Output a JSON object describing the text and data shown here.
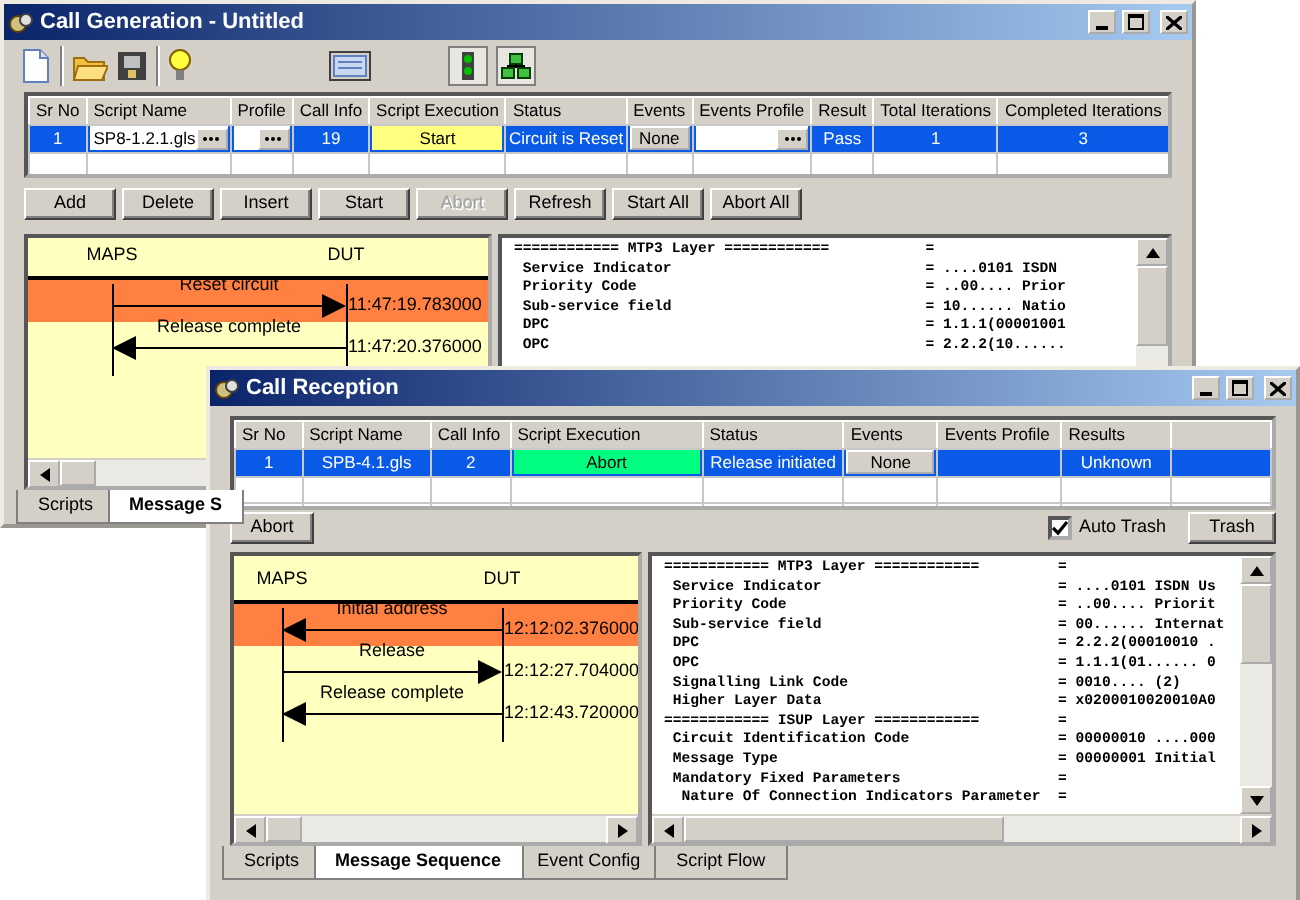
{
  "windows": [
    {
      "kind": "generation",
      "title": "Call Generation - Untitled",
      "table": {
        "columns": [
          "Sr No",
          "Script Name",
          "Profile",
          "Call Info",
          "Script Execution",
          "Status",
          "Events",
          "Events Profile",
          "Result",
          "Total Iterations",
          "Completed Iterations"
        ],
        "rows": [
          {
            "selected": true,
            "cells": [
              {
                "kind": "text",
                "text": "1"
              },
              {
                "kind": "combo",
                "text": "SP8-1.2.1.gls"
              },
              {
                "kind": "combo"
              },
              {
                "kind": "text",
                "text": "19"
              },
              {
                "kind": "exec",
                "text": "Start",
                "color": "#ffff80"
              },
              {
                "kind": "text",
                "text": "Circuit is Reset"
              },
              {
                "kind": "button",
                "text": "None"
              },
              {
                "kind": "combo"
              },
              {
                "kind": "text",
                "text": "Pass"
              },
              {
                "kind": "text",
                "text": "1"
              },
              {
                "kind": "text",
                "text": "3"
              }
            ]
          }
        ]
      },
      "buttons": [
        {
          "label": "Add",
          "disabled": false
        },
        {
          "label": "Delete",
          "disabled": false
        },
        {
          "label": "Insert",
          "disabled": false
        },
        {
          "label": "Start",
          "disabled": false
        },
        {
          "label": "Abort",
          "disabled": true
        },
        {
          "label": "Refresh",
          "disabled": false
        },
        {
          "label": "Start All",
          "disabled": false
        },
        {
          "label": "Abort All",
          "disabled": false
        }
      ],
      "sequence": {
        "lanes": [
          "MAPS",
          "DUT"
        ],
        "messages": [
          {
            "label": "Reset circuit",
            "kind": "right",
            "time": "11:47:19.783000",
            "selected": true
          },
          {
            "label": "Release complete",
            "kind": "left",
            "time": "11:47:20.376000",
            "selected": false
          }
        ]
      },
      "decode": [
        {
          "kind": "section",
          "field": "============ MTP3 Layer ============",
          "value": "="
        },
        {
          "kind": "field",
          "field": "Service Indicator",
          "value": "= ....0101 ISDN"
        },
        {
          "kind": "field",
          "field": "Priority Code",
          "value": "= ..00.... Prior"
        },
        {
          "kind": "field",
          "field": "Sub-service field",
          "value": "= 10...... Natio"
        },
        {
          "kind": "field",
          "field": "DPC",
          "value": "= 1.1.1(00001001"
        },
        {
          "kind": "field",
          "field": "OPC",
          "value": "= 2.2.2(10......"
        }
      ],
      "tabs": [
        {
          "label": "Scripts",
          "selected": false
        },
        {
          "label": "Message S",
          "selected": true
        }
      ]
    },
    {
      "kind": "reception",
      "title": "Call Reception",
      "table": {
        "columns": [
          "Sr No",
          "Script Name",
          "Call Info",
          "Script Execution",
          "Status",
          "Events",
          "Events Profile",
          "Results"
        ],
        "rows": [
          {
            "selected": true,
            "cells": [
              {
                "kind": "text",
                "text": "1"
              },
              {
                "kind": "text",
                "text": "SPB-4.1.gls"
              },
              {
                "kind": "text",
                "text": "2"
              },
              {
                "kind": "exec",
                "text": "Abort",
                "color": "#00ff80"
              },
              {
                "kind": "text",
                "text": "Release initiated"
              },
              {
                "kind": "button",
                "text": "None"
              },
              {
                "kind": "text"
              },
              {
                "kind": "text",
                "text": "Unknown"
              }
            ]
          }
        ]
      },
      "buttons": [
        {
          "label": "Abort",
          "disabled": false
        }
      ],
      "auto_trash": {
        "label": "Auto Trash",
        "checked": true
      },
      "trash_button": {
        "label": "Trash",
        "disabled": false
      },
      "sequence": {
        "lanes": [
          "MAPS",
          "DUT"
        ],
        "messages": [
          {
            "label": "Initial address",
            "kind": "left",
            "time": "12:12:02.376000",
            "selected": true
          },
          {
            "label": "Release",
            "kind": "right",
            "time": "12:12:27.704000",
            "selected": false
          },
          {
            "label": "Release complete",
            "kind": "left",
            "time": "12:12:43.720000",
            "selected": false
          }
        ]
      },
      "decode": [
        {
          "kind": "section",
          "field": "============ MTP3 Layer ============",
          "value": "="
        },
        {
          "kind": "field",
          "field": "Service Indicator",
          "value": "= ....0101 ISDN Us"
        },
        {
          "kind": "field",
          "field": "Priority Code",
          "value": "= ..00.... Priorit"
        },
        {
          "kind": "field",
          "field": "Sub-service field",
          "value": "= 00...... Internat"
        },
        {
          "kind": "field",
          "field": "DPC",
          "value": "= 2.2.2(00010010 ."
        },
        {
          "kind": "field",
          "field": "OPC",
          "value": "= 1.1.1(01...... 0"
        },
        {
          "kind": "field",
          "field": "Signalling Link Code",
          "value": "= 0010.... (2)"
        },
        {
          "kind": "field",
          "field": "Higher Layer Data",
          "value": "= x0200010020010A0"
        },
        {
          "kind": "section",
          "field": "============ ISUP Layer ============",
          "value": "="
        },
        {
          "kind": "field",
          "field": "Circuit Identification Code",
          "value": "= 00000010 ....000"
        },
        {
          "kind": "field",
          "field": "Message Type",
          "value": "= 00000001 Initial"
        },
        {
          "kind": "field",
          "field": "Mandatory Fixed Parameters",
          "value": "=",
          "children": [
            {
              "kind": "field",
              "field": "Nature Of Connection Indicators Parameter",
              "value": "="
            }
          ]
        }
      ],
      "tabs": [
        {
          "label": "Scripts",
          "selected": false
        },
        {
          "label": "Message Sequence",
          "selected": true
        },
        {
          "label": "Event Config",
          "selected": false
        },
        {
          "label": "Script Flow",
          "selected": false
        }
      ]
    }
  ]
}
